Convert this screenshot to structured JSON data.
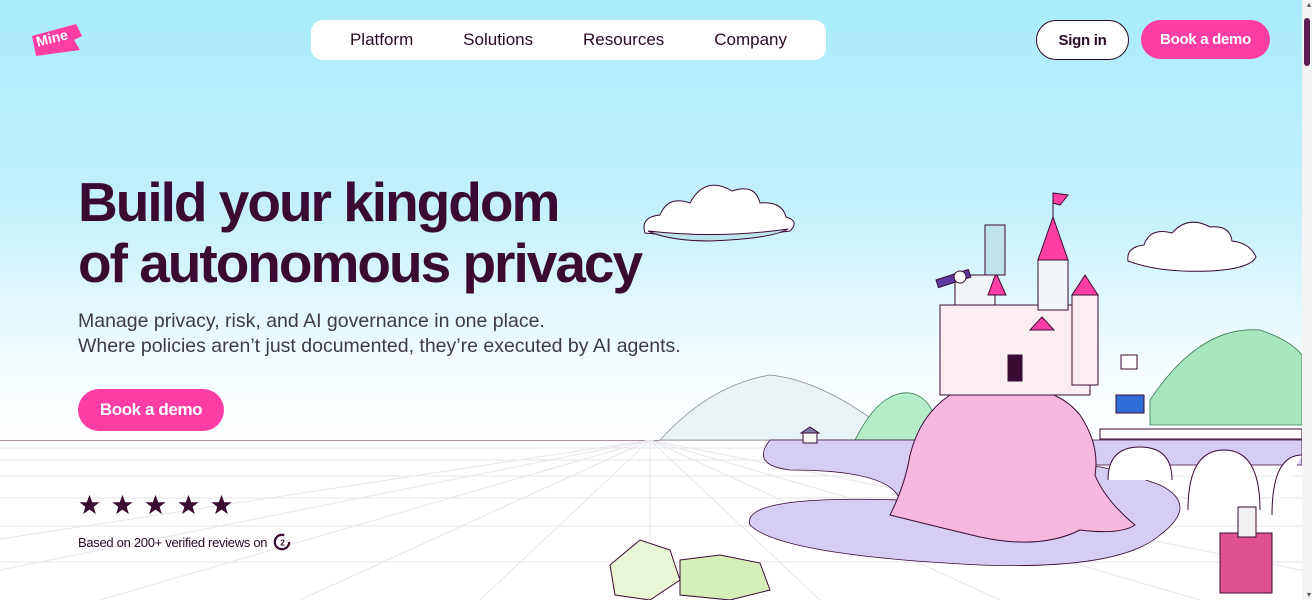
{
  "brand": {
    "logo_text": "Mine",
    "accent": "#ff3ea5",
    "dark": "#3b0a33"
  },
  "nav": {
    "items": [
      {
        "label": "Platform"
      },
      {
        "label": "Solutions"
      },
      {
        "label": "Resources"
      },
      {
        "label": "Company"
      }
    ]
  },
  "header": {
    "signin_label": "Sign in",
    "demo_label": "Book a demo"
  },
  "hero": {
    "headline_line1": "Build your kingdom",
    "headline_line2": "of autonomous privacy",
    "sub_line1": "Manage privacy, risk, and AI governance in one place.",
    "sub_line2": "Where policies aren’t just documented, they’re executed by AI agents.",
    "cta_label": "Book a demo"
  },
  "rating": {
    "stars": 5,
    "reviews_text": "Based on 200+ verified reviews on",
    "platform_icon": "g2-icon"
  }
}
